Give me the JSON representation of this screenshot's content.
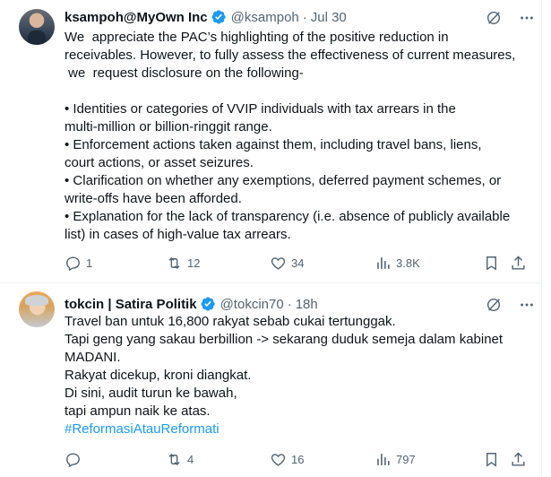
{
  "tweets": [
    {
      "display_name": "ksampoh@MyOwn Inc",
      "handle": "@ksampoh",
      "separator": "·",
      "time": "Jul 30",
      "lines": [
        "We  appreciate the PAC’s highlighting of the positive reduction in",
        "receivables. However, to fully assess the effectiveness of current measures,",
        " we  request disclosure on the following-",
        "",
        "• Identities or categories of VVIP individuals with tax arrears in the",
        "multi-million or billion-ringgit range.",
        "• Enforcement actions taken against them, including travel bans, liens,",
        "court actions, or asset seizures.",
        "• Clarification on whether any exemptions, deferred payment schemes, or",
        "write-offs have been afforded.",
        "• Explanation for the lack of transparency (i.e. absence of publicly available",
        "list) in cases of high-value tax arrears."
      ],
      "hashtag": "",
      "replies": "1",
      "reposts": "12",
      "likes": "34",
      "views": "3.8K"
    },
    {
      "display_name": "tokcin | Satira Politik",
      "handle": "@tokcin70",
      "separator": "·",
      "time": "18h",
      "lines": [
        "Travel ban untuk 16,800 rakyat sebab cukai tertunggak.",
        "Tapi geng yang sakau berbillion -> sekarang duduk semeja dalam kabinet",
        "MADANI.",
        "Rakyat dicekup, kroni diangkat.",
        "Di sini, audit turun ke bawah,",
        "tapi ampun naik ke atas."
      ],
      "hashtag": "#ReformasiAtauReformati",
      "replies": "",
      "reposts": "4",
      "likes": "16",
      "views": "797"
    }
  ],
  "colors": {
    "text": "#0f1419",
    "secondary": "#536471",
    "accent": "#1d9bf0",
    "divider": "#eff3f4"
  },
  "icons": [
    "verified-badge-icon",
    "grok-icon",
    "more-icon",
    "reply-icon",
    "repost-icon",
    "like-icon",
    "views-icon",
    "bookmark-icon",
    "share-icon"
  ]
}
